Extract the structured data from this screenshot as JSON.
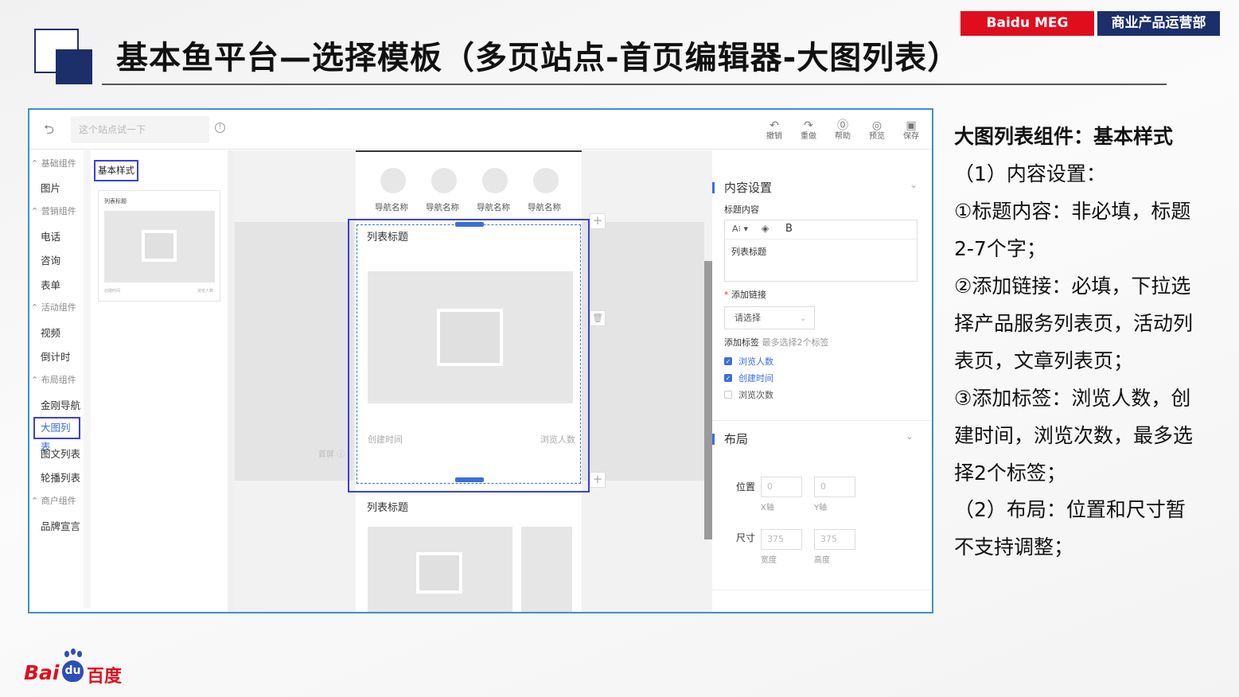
{
  "header": {
    "brand_left": "Baidu MEG",
    "brand_right": "商业产品运营部",
    "title": "基本鱼平台—选择模板（多页站点-首页编辑器-大图列表）",
    "colors": {
      "brand_red": "#e00d1d",
      "brand_blue": "#1c2f6b",
      "accent": "#3a3fe0"
    }
  },
  "app": {
    "topbar": {
      "site_placeholder": "这个站点试一下",
      "actions": [
        {
          "label": "撤销",
          "icon": "undo-icon"
        },
        {
          "label": "重做",
          "icon": "redo-icon"
        },
        {
          "label": "帮助",
          "icon": "help-icon"
        },
        {
          "label": "预览",
          "icon": "preview-icon"
        },
        {
          "label": "保存",
          "icon": "save-icon"
        }
      ]
    },
    "sidebar": {
      "cat1": "基础组件",
      "item_image": "图片",
      "cat2": "营销组件",
      "item_phone": "电话",
      "item_consult": "咨询",
      "item_form": "表单",
      "cat3": "活动组件",
      "item_video": "视频",
      "item_countdown": "倒计时",
      "cat4": "布局组件",
      "item_nav": "金刚导航",
      "item_biglist": "大图列表",
      "item_textlist": "图文列表",
      "item_carousel": "轮播列表",
      "cat5": "商户组件",
      "item_brand": "品牌宣言"
    },
    "style_panel": {
      "label": "基本样式",
      "thumb_title": "列表标题",
      "thumb_left": "创建时间",
      "thumb_right": "浏览人数"
    },
    "canvas": {
      "nav_item": "导航名称",
      "card_title": "列表标题",
      "card_left": "创建时间",
      "card_right": "浏览人数",
      "second_title": "列表标题",
      "first_screen": "首屏"
    },
    "right_panel": {
      "content_heading": "内容设置",
      "title_content": "标题内容",
      "toolbar_font": "A⁝ ▾",
      "toolbar_bold": "B",
      "title_value": "列表标题",
      "add_link": "添加链接",
      "link_select": "请选择",
      "add_tag": "添加标签",
      "tag_hint": "最多选择2个标签",
      "tag1": "浏览人数",
      "tag1_checked": true,
      "tag2": "创建时间",
      "tag2_checked": true,
      "tag3": "浏览次数",
      "tag3_checked": false,
      "layout_heading": "布局",
      "position_label": "位置",
      "x_value": "0",
      "y_value": "0",
      "x_label": "X轴",
      "y_label": "Y轴",
      "size_label": "尺寸",
      "width_value": "375",
      "height_value": "375",
      "width_label": "宽度",
      "height_label": "高度"
    }
  },
  "notes": {
    "heading": "大图列表组件：基本样式",
    "lines": [
      "（1）内容设置：",
      "①标题内容：非必填，标题",
      "2-7个字；",
      "②添加链接：必填，下拉选",
      "择产品服务列表页，活动列",
      "表页，文章列表页；",
      "③添加标签：浏览人数，创",
      "建时间，浏览次数，最多选",
      "择2个标签；",
      "（2）布局：位置和尺寸暂",
      "不支持调整；"
    ]
  },
  "footer": {
    "logo_text_1": "Bai",
    "logo_text_2": "du",
    "logo_text_3": "百度"
  }
}
